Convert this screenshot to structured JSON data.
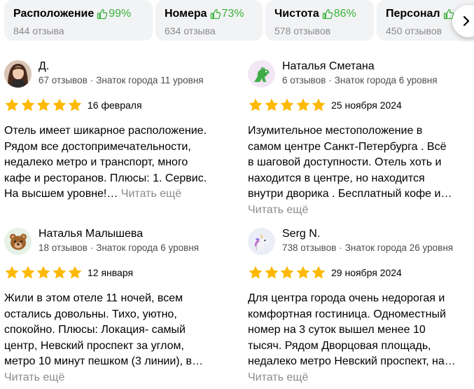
{
  "aspects": [
    {
      "name": "Расположение",
      "percent": "99%",
      "count": "844 отзыва"
    },
    {
      "name": "Номера",
      "percent": "73%",
      "count": "634 отзыва"
    },
    {
      "name": "Чистота",
      "percent": "86%",
      "count": "578 отзывов"
    },
    {
      "name": "Персонал",
      "percent": "",
      "count": "450 отзывов"
    }
  ],
  "colors": {
    "positive": "#3bb33b",
    "star": "#fdb904",
    "muted": "#8c8c8c",
    "chip_bg": "#f2f3f5"
  },
  "reviews": [
    {
      "author": "Д.",
      "reviews_count": "67 отзывов",
      "badge": "Знаток города 11 уровня",
      "date": "16 февраля",
      "rating": 5,
      "avatar": "photo-avatar",
      "text_lines": [
        "Отель имеет шикарное расположение.",
        "Рядом все достопримечательности,",
        "недалеко метро и транспорт, много",
        "кафе и ресторанов. Плюсы: 1. Сервис.",
        "На высшем уровне!…"
      ],
      "read_more": "Читать ещё"
    },
    {
      "author": "Наталья Сметана",
      "reviews_count": "6 отзывов",
      "badge": "Знаток города 6 уровня",
      "date": "25 ноября 2024",
      "rating": 5,
      "avatar": "dinosaur-avatar",
      "text_lines": [
        "Изумительное местоположение в",
        "самом центре Санкт-Петербурга . Всё",
        "в шаговой доступности. Отель хоть и",
        "находится в центре, но находится",
        "внутри дворика . Бесплатный кофе и…"
      ],
      "read_more": "Читать ещё"
    },
    {
      "author": "Наталья Малышева",
      "reviews_count": "18 отзывов",
      "badge": "Знаток города 6 уровня",
      "date": "12 января",
      "rating": 5,
      "avatar": "bear-avatar",
      "text_lines": [
        "Жили в этом отеле 11 ночей, всем",
        "остались довольны. Тихо, уютно,",
        "спокойно. Плюсы: Локация- самый",
        "центр, Невский проспект за углом,",
        "метро 10 минут пешком (3 линии), в…"
      ],
      "read_more": "Читать ещё"
    },
    {
      "author": "Serg N.",
      "reviews_count": "738 отзывов",
      "badge": "Знаток города 26 уровня",
      "date": "29 ноября 2024",
      "rating": 5,
      "avatar": "unicorn-avatar",
      "text_lines": [
        "Для центра города очень недорогая и",
        "комфортная гостиница. Одноместный",
        "номер на 3 суток вышел менее 10",
        "тысяч. Рядом Дворцовая площадь,",
        "недалеко метро Невский проспект, на…"
      ],
      "read_more": "Читать ещё"
    }
  ]
}
